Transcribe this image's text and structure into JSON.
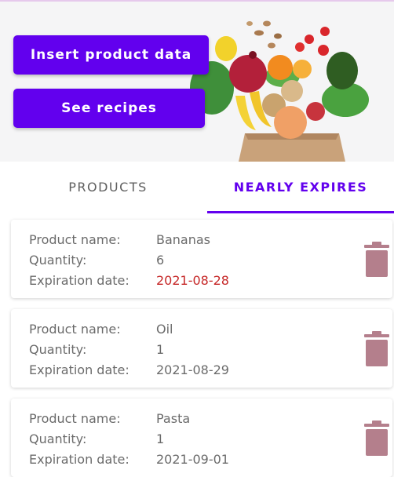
{
  "header": {
    "insert_label": "Insert product data",
    "recipes_label": "See recipes"
  },
  "tabs": [
    {
      "label": "PRODUCTS",
      "active": false
    },
    {
      "label": "NEARLY EXPIRES",
      "active": true
    }
  ],
  "labels": {
    "name": "Product name:",
    "quantity": "Quantity:",
    "expiration": "Expiration date:"
  },
  "products": [
    {
      "name": "Bananas",
      "quantity": "6",
      "expiration": "2021-08-28",
      "expired": true
    },
    {
      "name": "Oil",
      "quantity": "1",
      "expiration": "2021-08-29",
      "expired": false
    },
    {
      "name": "Pasta",
      "quantity": "1",
      "expiration": "2021-09-01",
      "expired": false
    }
  ],
  "colors": {
    "accent": "#6200ee",
    "expired": "#c62828",
    "delete_icon": "#b47f8c"
  },
  "icons": {
    "delete": "trash-icon",
    "hero": "groceries-image"
  }
}
